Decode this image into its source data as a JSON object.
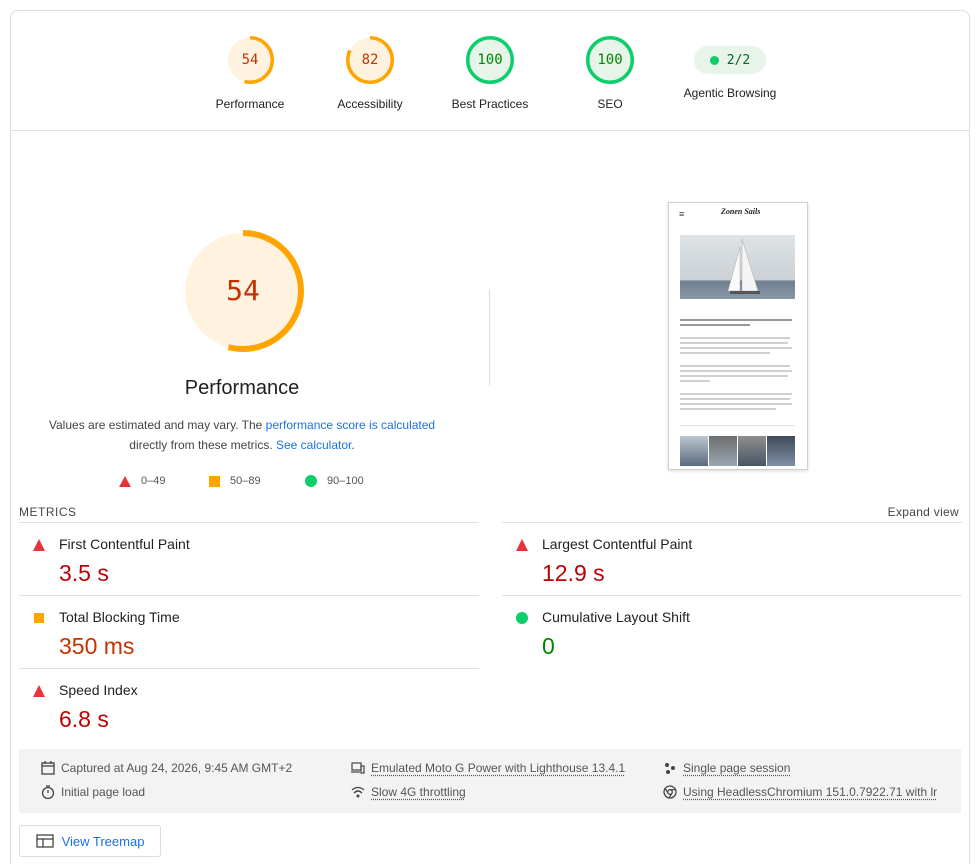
{
  "categories": [
    {
      "label": "Performance",
      "score": "54",
      "value": 0.54,
      "color": "#ffa400",
      "bg": "#fff3e0",
      "text": "#c33300"
    },
    {
      "label": "Accessibility",
      "score": "82",
      "value": 0.82,
      "color": "#ffa400",
      "bg": "#fff3e0",
      "text": "#c33300"
    },
    {
      "label": "Best Practices",
      "score": "100",
      "value": 1.0,
      "color": "#0cce6b",
      "bg": "#e6f4ea",
      "text": "#008800"
    },
    {
      "label": "SEO",
      "score": "100",
      "value": 1.0,
      "color": "#0cce6b",
      "bg": "#e6f4ea",
      "text": "#008800"
    }
  ],
  "agentic": {
    "label": "Agentic Browsing",
    "score": "2/2"
  },
  "performance": {
    "score": "54",
    "value": 0.54,
    "title": "Performance",
    "desc_1": "Values are estimated and may vary. The ",
    "desc_link_1": "performance score is calculated",
    "desc_2": "directly from these metrics. ",
    "desc_link_2": "See calculator",
    "desc_end": "."
  },
  "legend": {
    "fail": "0–49",
    "average": "50–89",
    "pass": "90–100"
  },
  "metrics": {
    "header": "METRICS",
    "expand": "Expand view",
    "fcp": {
      "name": "First Contentful Paint",
      "value": "3.5 s"
    },
    "lcp": {
      "name": "Largest Contentful Paint",
      "value": "12.9 s"
    },
    "tbt": {
      "name": "Total Blocking Time",
      "value": "350 ms"
    },
    "cls": {
      "name": "Cumulative Layout Shift",
      "value": "0"
    },
    "si": {
      "name": "Speed Index",
      "value": "6.8 s"
    }
  },
  "info": {
    "captured": "Captured at Aug 24, 2026, 9:45 AM GMT+2",
    "initial": "Initial page load",
    "emulated": "Emulated Moto G Power with Lighthouse 13.4.1",
    "throttling": "Slow 4G throttling",
    "session": "Single page session",
    "browser": "Using HeadlessChromium 151.0.7922.71 with lr"
  },
  "treemap": "View Treemap",
  "thumbnail": {
    "menu": "≡",
    "logo": "Zonen Sails"
  },
  "colors": {
    "fail": "#e8333b",
    "average": "#ffa400",
    "pass": "#0cce6b",
    "failText": "#c00000",
    "avgText": "#c33300",
    "passText": "#008800"
  }
}
